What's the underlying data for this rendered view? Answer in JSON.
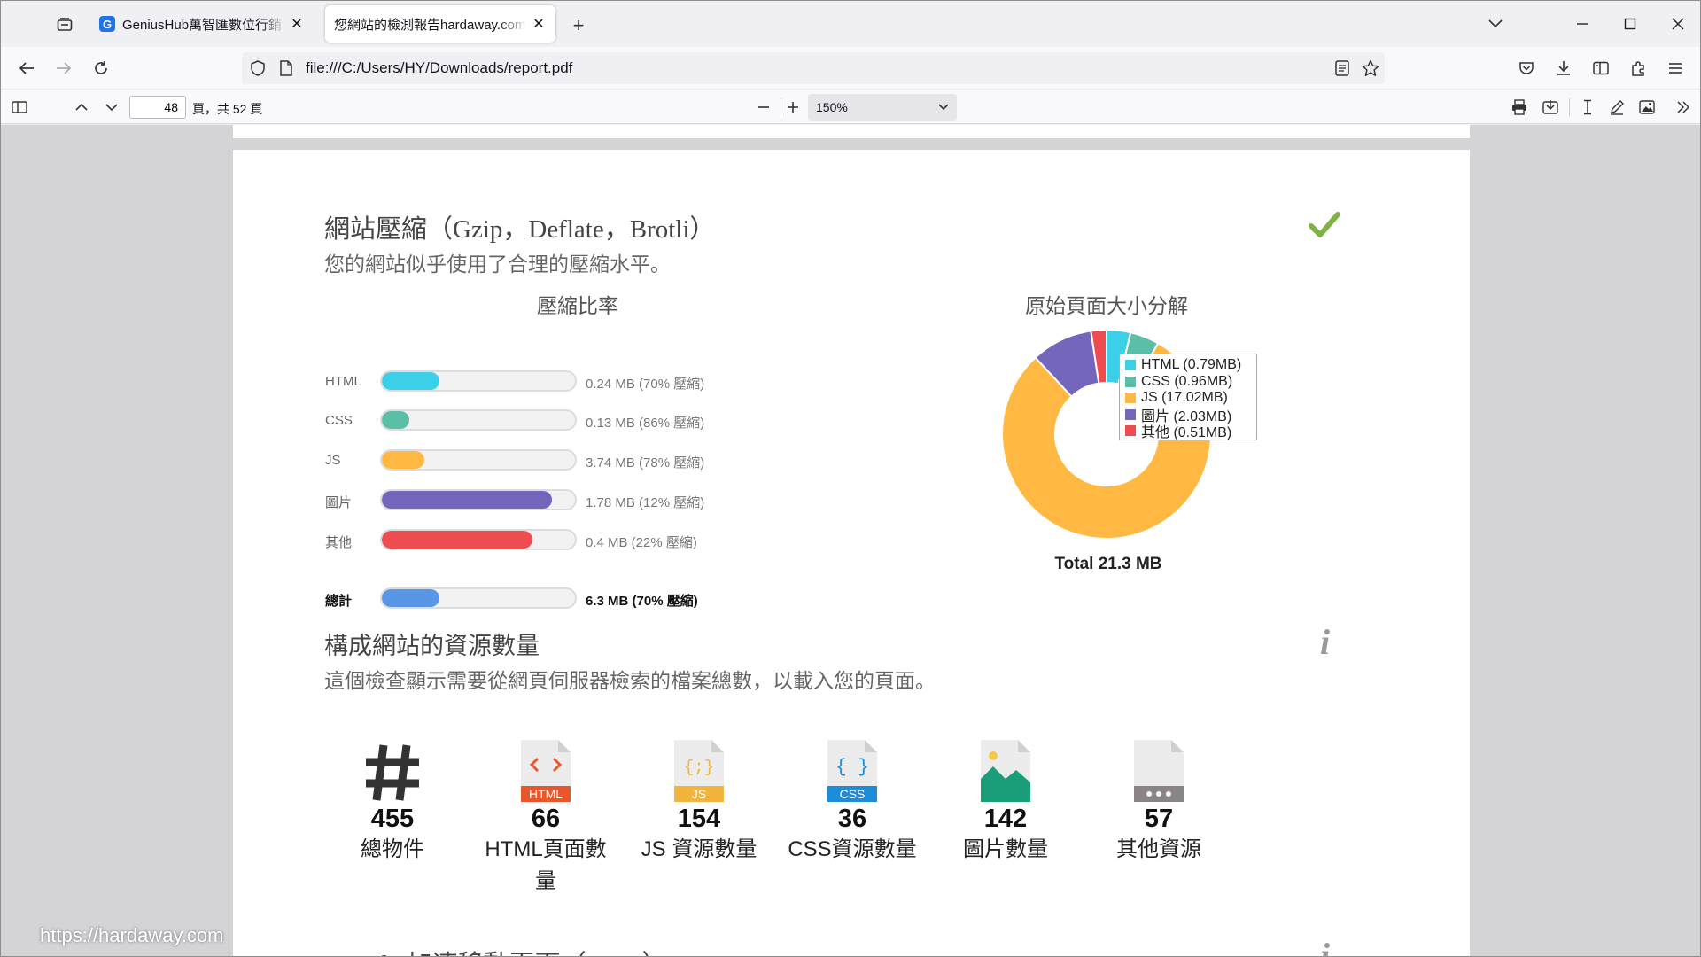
{
  "browser": {
    "tabs": [
      {
        "favicon": "G",
        "title": "GeniusHub萬智匯數位行銷 - 全",
        "active": false
      },
      {
        "title": "您網站的檢測報告hardaway.com.tw",
        "active": true
      }
    ],
    "new_tab": "+",
    "url": "file:///C:/Users/HY/Downloads/report.pdf"
  },
  "pdf_toolbar": {
    "page_number": "48",
    "page_total": "頁，共 52 頁",
    "zoom": "150%"
  },
  "compression": {
    "title": "網站壓縮（Gzip，Deflate，Brotli）",
    "subtitle": "您的網站似乎使用了合理的壓縮水平。",
    "status_icon": "checkmark-icon",
    "status_color": "#7cb342"
  },
  "chart_data": [
    {
      "type": "bar",
      "title": "壓縮比率",
      "categories": [
        "HTML",
        "CSS",
        "JS",
        "圖片",
        "其他",
        "總計"
      ],
      "values": [
        0.3,
        0.14,
        0.22,
        0.88,
        0.78,
        0.3
      ],
      "value_labels": [
        "0.24 MB (70% 壓縮)",
        "0.13 MB (86% 壓縮)",
        "3.74 MB (78% 壓縮)",
        "1.78 MB (12% 壓縮)",
        "0.4 MB (22% 壓縮)",
        "6.3 MB (70% 壓縮)"
      ],
      "colors": [
        "#3ccfe8",
        "#5bbfa8",
        "#ffb943",
        "#7465bd",
        "#ee4c50",
        "#5896e8"
      ]
    },
    {
      "type": "pie",
      "title": "原始頁面大小分解",
      "labels": [
        "HTML",
        "CSS",
        "JS",
        "圖片",
        "其他"
      ],
      "values": [
        0.79,
        0.96,
        17.02,
        2.03,
        0.51
      ],
      "legend": [
        "HTML (0.79MB)",
        "CSS (0.96MB)",
        "JS (17.02MB)",
        "圖片 (2.03MB)",
        "其他 (0.51MB)"
      ],
      "colors": [
        "#3ccfe8",
        "#5bbfa8",
        "#ffb943",
        "#7465bd",
        "#ee4c50"
      ],
      "total_label": "Total 21.3 MB"
    }
  ],
  "resources": {
    "title": "構成網站的資源數量",
    "subtitle": "這個檢查顯示需要從網頁伺服器檢索的檔案總數，以載入您的頁面。",
    "info_icon": "i",
    "items": [
      {
        "icon": "hash-icon",
        "count": "455",
        "label": "總物件"
      },
      {
        "icon": "html-file-icon",
        "badge": "HTML",
        "count": "66",
        "label": "HTML頁面數量"
      },
      {
        "icon": "js-file-icon",
        "badge": "JS",
        "count": "154",
        "label": "JS 資源數量"
      },
      {
        "icon": "css-file-icon",
        "badge": "CSS",
        "count": "36",
        "label": "CSS資源數量"
      },
      {
        "icon": "image-file-icon",
        "count": "142",
        "label": "圖片數量"
      },
      {
        "icon": "other-file-icon",
        "count": "57",
        "label": "其他資源"
      }
    ]
  },
  "next_section": {
    "title": "Google 加速移動頁面（AMP）",
    "info_icon": "i"
  },
  "watermark": "https://hardaway.com"
}
